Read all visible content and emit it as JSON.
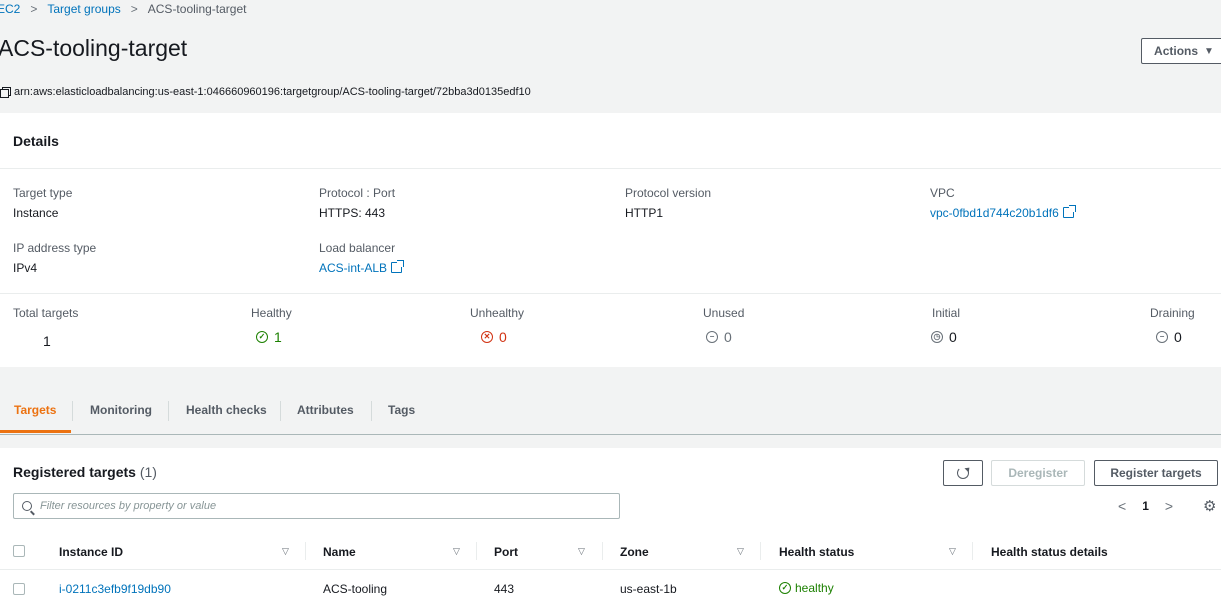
{
  "breadcrumb": {
    "items": [
      {
        "label": "EC2"
      },
      {
        "label": "Target groups"
      },
      {
        "label": "ACS-tooling-target"
      }
    ]
  },
  "page": {
    "title": "ACS-tooling-target",
    "actions_label": "Actions",
    "arn": "arn:aws:elasticloadbalancing:us-east-1:046660960196:targetgroup/ACS-tooling-target/72bba3d0135edf10"
  },
  "details": {
    "title": "Details",
    "target_type_label": "Target type",
    "target_type": "Instance",
    "protocol_port_label": "Protocol : Port",
    "protocol_port": "HTTPS: 443",
    "protocol_version_label": "Protocol version",
    "protocol_version": "HTTP1",
    "vpc_label": "VPC",
    "vpc": "vpc-0fbd1d744c20b1df6",
    "ip_type_label": "IP address type",
    "ip_type": "IPv4",
    "lb_label": "Load balancer",
    "lb": "ACS-int-ALB"
  },
  "summary": {
    "total_label": "Total targets",
    "total": "1",
    "healthy_label": "Healthy",
    "healthy": "1",
    "unhealthy_label": "Unhealthy",
    "unhealthy": "0",
    "unused_label": "Unused",
    "unused": "0",
    "initial_label": "Initial",
    "initial": "0",
    "draining_label": "Draining",
    "draining": "0"
  },
  "tabs": [
    "Targets",
    "Monitoring",
    "Health checks",
    "Attributes",
    "Tags"
  ],
  "registered": {
    "title": "Registered targets",
    "count": "(1)",
    "deregister_label": "Deregister",
    "register_label": "Register targets",
    "filter_placeholder": "Filter resources by property or value",
    "page": "1",
    "columns": [
      "Instance ID",
      "Name",
      "Port",
      "Zone",
      "Health status",
      "Health status details"
    ],
    "rows": [
      {
        "instance_id": "i-0211c3efb9f19db90",
        "name": "ACS-tooling",
        "port": "443",
        "zone": "us-east-1b",
        "health": "healthy",
        "details": ""
      }
    ]
  },
  "colors": {
    "link": "#0073bb",
    "accent": "#ec7211",
    "healthy": "#1d8102",
    "unhealthy": "#d13212"
  }
}
